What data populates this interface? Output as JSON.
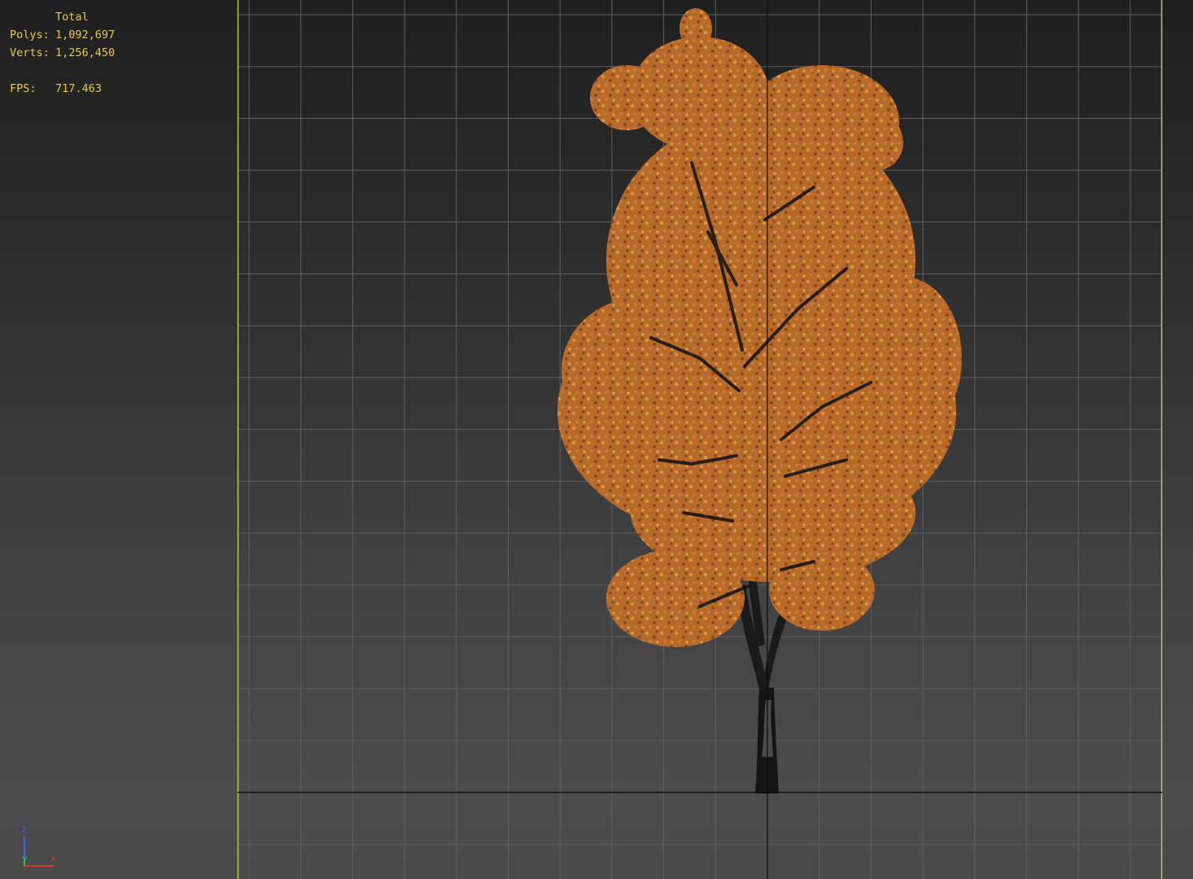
{
  "stats": {
    "header": "Total",
    "rows": [
      {
        "label": "Polys:",
        "value": "1,092,697"
      },
      {
        "label": "Verts:",
        "value": "1,256,450"
      },
      {
        "label": "FPS:",
        "value": "717.463"
      }
    ]
  },
  "gizmo": {
    "z": "z",
    "y": "y",
    "x": "x"
  },
  "colors": {
    "stats_text": "#e4c94b",
    "viewport_border": "#c9c34a",
    "grid_line": "#5f5f5f",
    "axis_line": "#0d0d0d",
    "foliage": "#b8682a",
    "trunk": "#1a1a1a",
    "gizmo_z": "#3f5fe6",
    "gizmo_y": "#31c23a",
    "gizmo_x": "#d33a2e"
  },
  "icons": {
    "axis_gizmo": "xyz-axis-tripod-icon"
  }
}
